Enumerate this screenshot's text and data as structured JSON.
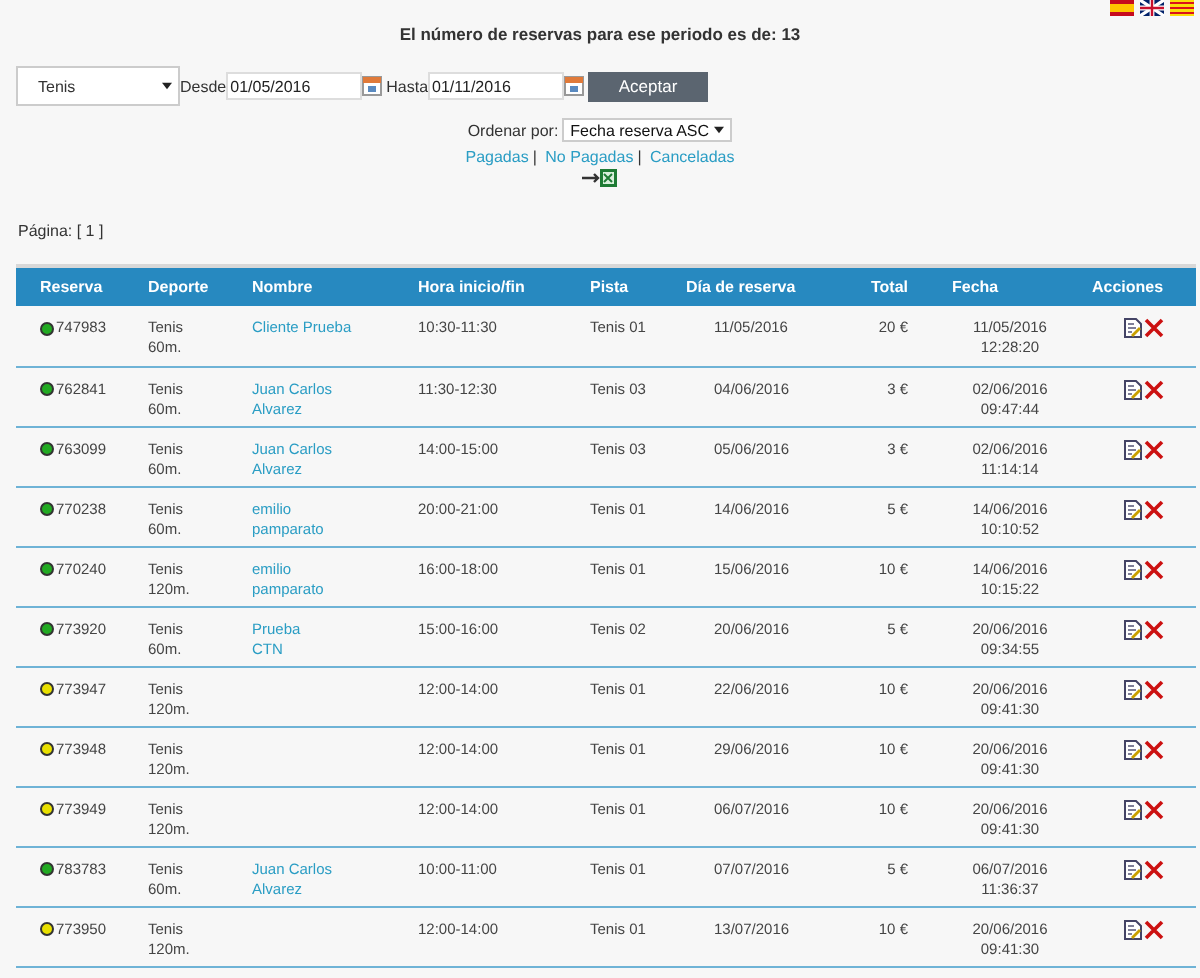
{
  "languages": [
    {
      "kind": "es"
    },
    {
      "kind": "en"
    },
    {
      "kind": "ca"
    }
  ],
  "summary": "El número de reservas para ese periodo es de: 13",
  "filters": {
    "sport": "Tenis",
    "from_label": "Desde",
    "from": "01/05/2016",
    "to_label": "Hasta",
    "to": "01/11/2016",
    "submit": "Aceptar"
  },
  "sort": {
    "label": "Ordenar por:",
    "value": "Fecha reserva ASC"
  },
  "status_links": [
    "Pagadas",
    "No Pagadas",
    "Canceladas"
  ],
  "link_separator": "|",
  "pagination": "Página: [ 1 ]",
  "table": {
    "columns": [
      "Reserva",
      "Deporte",
      "Nombre",
      "Hora inicio/fin",
      "Pista",
      "Día de reserva",
      "Total",
      "Fecha",
      "Acciones"
    ],
    "rows": [
      {
        "id": "747983",
        "color": "#22aa22",
        "sport": [
          "Tenis",
          "60m."
        ],
        "name": [
          "Cliente Prueba"
        ],
        "time": "10:30-11:30",
        "court": "Tenis 01",
        "day": "11/05/2016",
        "total": "20 €",
        "date": [
          "11/05/2016",
          "12:28:20"
        ]
      },
      {
        "id": "762841",
        "color": "#22aa22",
        "sport": [
          "Tenis",
          "60m."
        ],
        "name": [
          "Juan Carlos",
          "Alvarez"
        ],
        "time": "11:30-12:30",
        "court": "Tenis 03",
        "day": "04/06/2016",
        "total": "3 €",
        "date": [
          "02/06/2016",
          "09:47:44"
        ]
      },
      {
        "id": "763099",
        "color": "#22aa22",
        "sport": [
          "Tenis",
          "60m."
        ],
        "name": [
          "Juan Carlos",
          "Alvarez"
        ],
        "time": "14:00-15:00",
        "court": "Tenis 03",
        "day": "05/06/2016",
        "total": "3 €",
        "date": [
          "02/06/2016",
          "11:14:14"
        ]
      },
      {
        "id": "770238",
        "color": "#22aa22",
        "sport": [
          "Tenis",
          "60m."
        ],
        "name": [
          "emilio",
          "pamparato"
        ],
        "time": "20:00-21:00",
        "court": "Tenis 01",
        "day": "14/06/2016",
        "total": "5 €",
        "date": [
          "14/06/2016",
          "10:10:52"
        ]
      },
      {
        "id": "770240",
        "color": "#22aa22",
        "sport": [
          "Tenis",
          "120m."
        ],
        "name": [
          "emilio",
          "pamparato"
        ],
        "time": "16:00-18:00",
        "court": "Tenis 01",
        "day": "15/06/2016",
        "total": "10 €",
        "date": [
          "14/06/2016",
          "10:15:22"
        ]
      },
      {
        "id": "773920",
        "color": "#22aa22",
        "sport": [
          "Tenis",
          "60m."
        ],
        "name": [
          "Prueba",
          "CTN"
        ],
        "time": "15:00-16:00",
        "court": "Tenis 02",
        "day": "20/06/2016",
        "total": "5 €",
        "date": [
          "20/06/2016",
          "09:34:55"
        ]
      },
      {
        "id": "773947",
        "color": "#e8e000",
        "sport": [
          "Tenis",
          "120m."
        ],
        "time": "12:00-14:00",
        "court": "Tenis 01",
        "day": "22/06/2016",
        "total": "10 €",
        "date": [
          "20/06/2016",
          "09:41:30"
        ]
      },
      {
        "id": "773948",
        "color": "#e8e000",
        "sport": [
          "Tenis",
          "120m."
        ],
        "time": "12:00-14:00",
        "court": "Tenis 01",
        "day": "29/06/2016",
        "total": "10 €",
        "date": [
          "20/06/2016",
          "09:41:30"
        ]
      },
      {
        "id": "773949",
        "color": "#e8e000",
        "sport": [
          "Tenis",
          "120m."
        ],
        "time": "12:00-14:00",
        "court": "Tenis 01",
        "day": "06/07/2016",
        "total": "10 €",
        "date": [
          "20/06/2016",
          "09:41:30"
        ]
      },
      {
        "id": "783783",
        "color": "#22aa22",
        "sport": [
          "Tenis",
          "60m."
        ],
        "name": [
          "Juan Carlos",
          "Alvarez"
        ],
        "time": "10:00-11:00",
        "court": "Tenis 01",
        "day": "07/07/2016",
        "total": "5 €",
        "date": [
          "06/07/2016",
          "11:36:37"
        ]
      },
      {
        "id": "773950",
        "color": "#e8e000",
        "sport": [
          "Tenis",
          "120m."
        ],
        "time": "12:00-14:00",
        "court": "Tenis 01",
        "day": "13/07/2016",
        "total": "10 €",
        "date": [
          "20/06/2016",
          "09:41:30"
        ]
      }
    ]
  }
}
